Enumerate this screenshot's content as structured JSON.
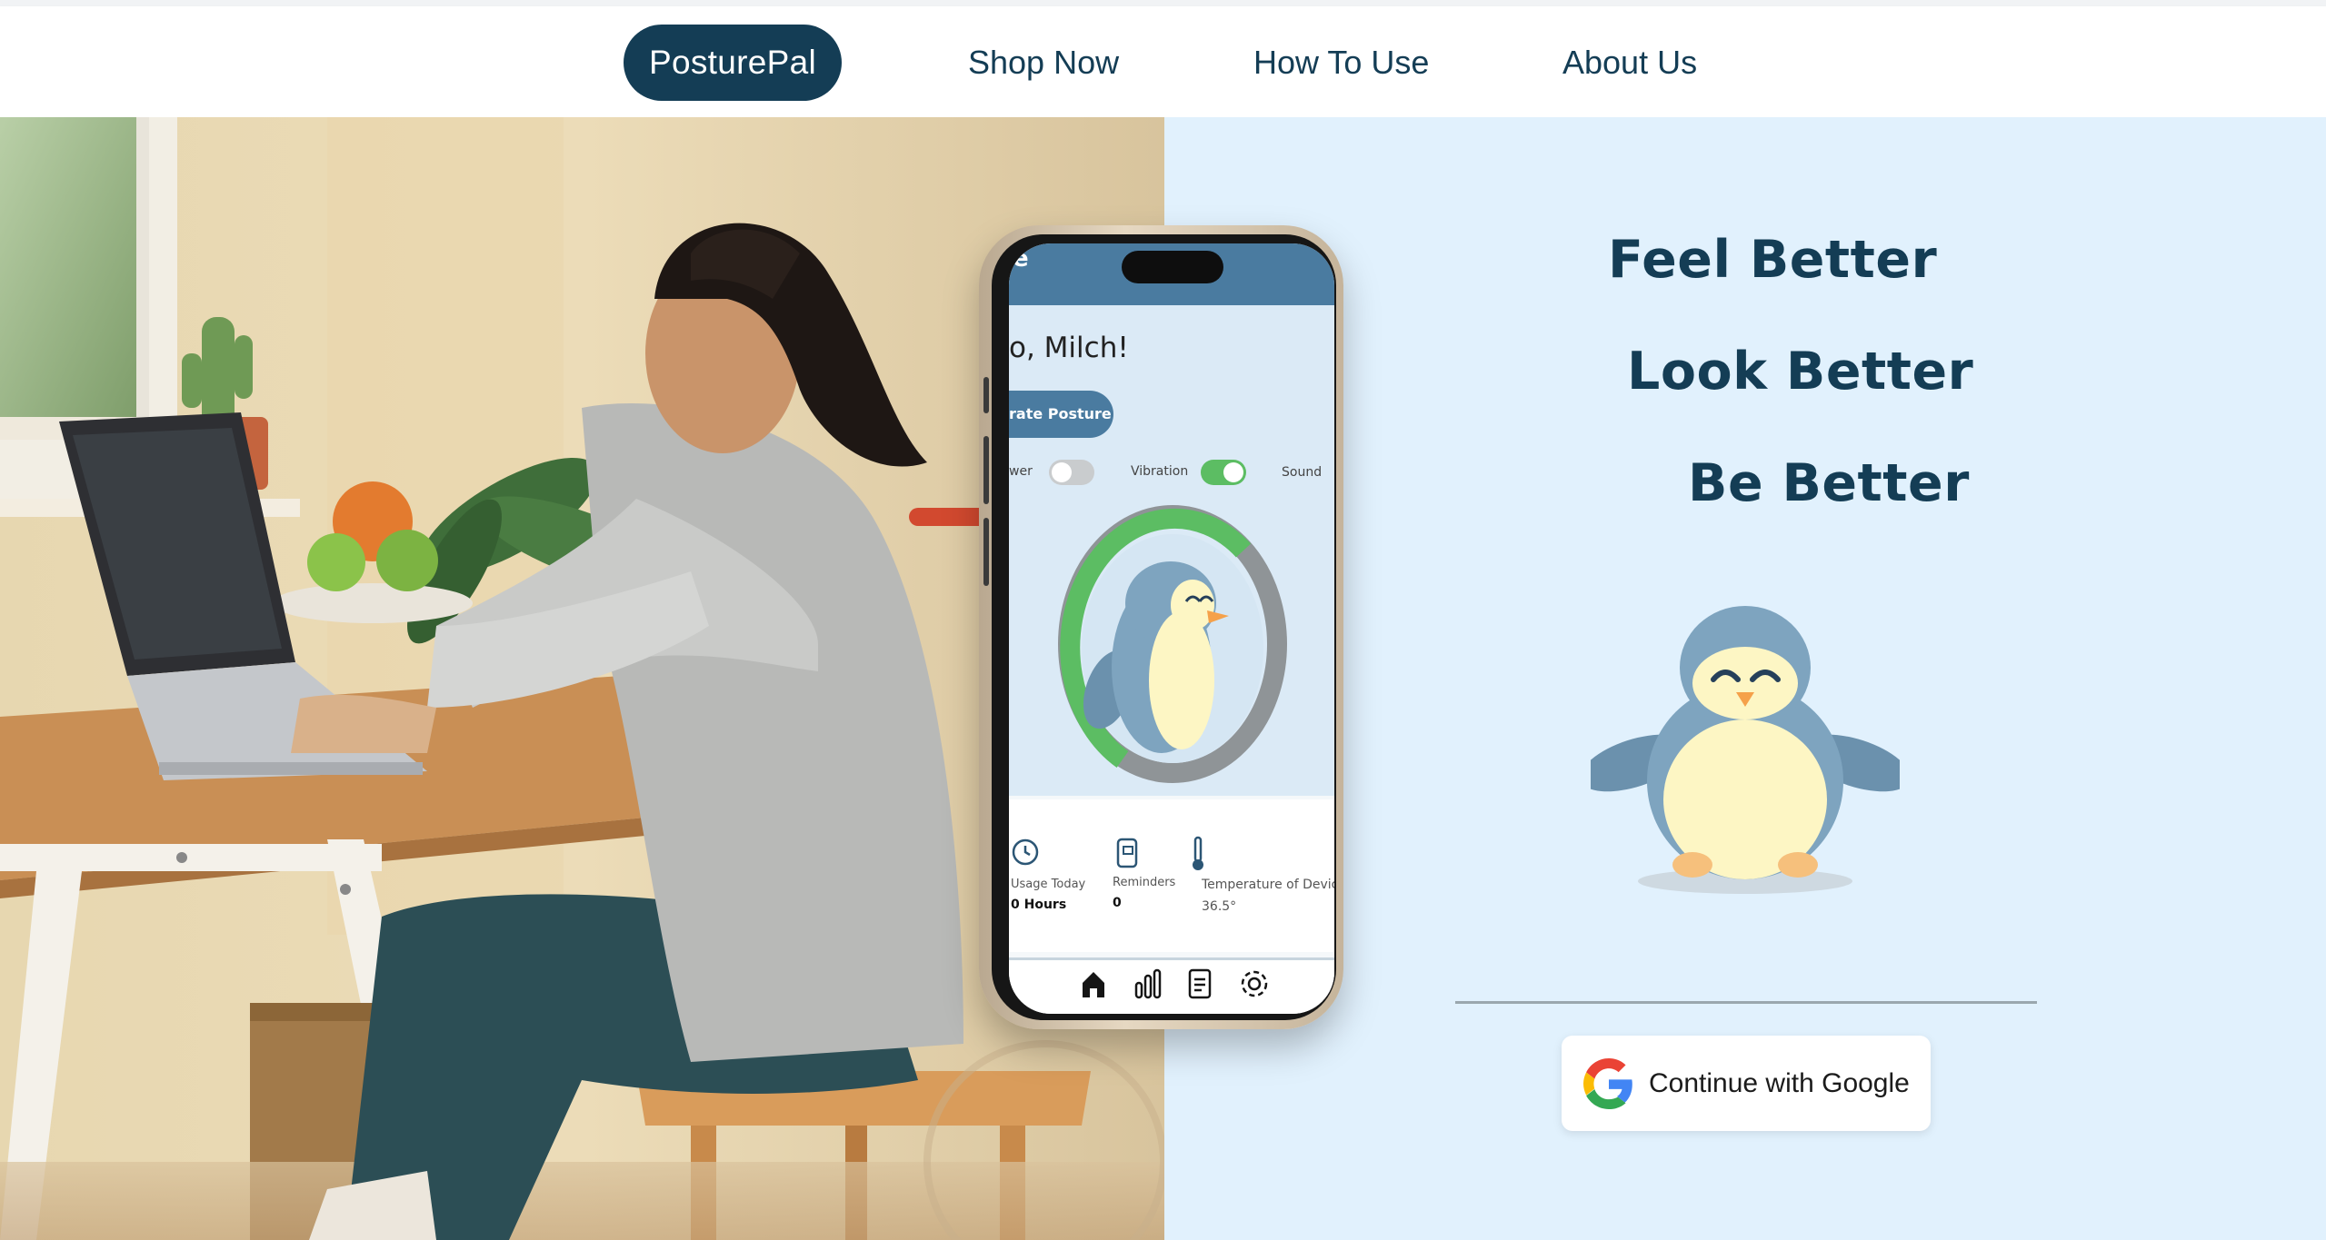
{
  "nav": {
    "brand": "PosturePal",
    "links": [
      "Shop Now",
      "How To Use",
      "About Us"
    ]
  },
  "hero": {
    "headlines": [
      "Feel Better",
      "Look Better",
      "Be Better"
    ],
    "google_button": "Continue with Google"
  },
  "phone": {
    "header_partial": "e",
    "greeting": "o, Milch!",
    "calibrate_button": "rate Posture",
    "toggles": [
      {
        "label": "wer",
        "on": false
      },
      {
        "label": "Vibration",
        "on": true
      },
      {
        "label": "Sound"
      }
    ],
    "stats": [
      {
        "label": "Usage Today",
        "value": "0 Hours",
        "icon": "clock-icon"
      },
      {
        "label": "Reminders",
        "value": "0",
        "icon": "phone-reminder-icon"
      },
      {
        "label": "Temperature of Device",
        "value": "36.5°",
        "icon": "thermometer-icon"
      }
    ],
    "bottom_nav_icons": [
      "home-icon",
      "chart-icon",
      "document-icon",
      "settings-icon"
    ],
    "posture_ring_good_fraction": 0.55
  },
  "colors": {
    "brand_dark": "#143d55",
    "panel_bg": "#e1f1fd",
    "toggle_on": "#5cbd63",
    "ring_good": "#5cbd63",
    "ring_rest": "#8f9497",
    "penguin_body": "#7ea4bf",
    "penguin_belly": "#fdf6c4"
  }
}
